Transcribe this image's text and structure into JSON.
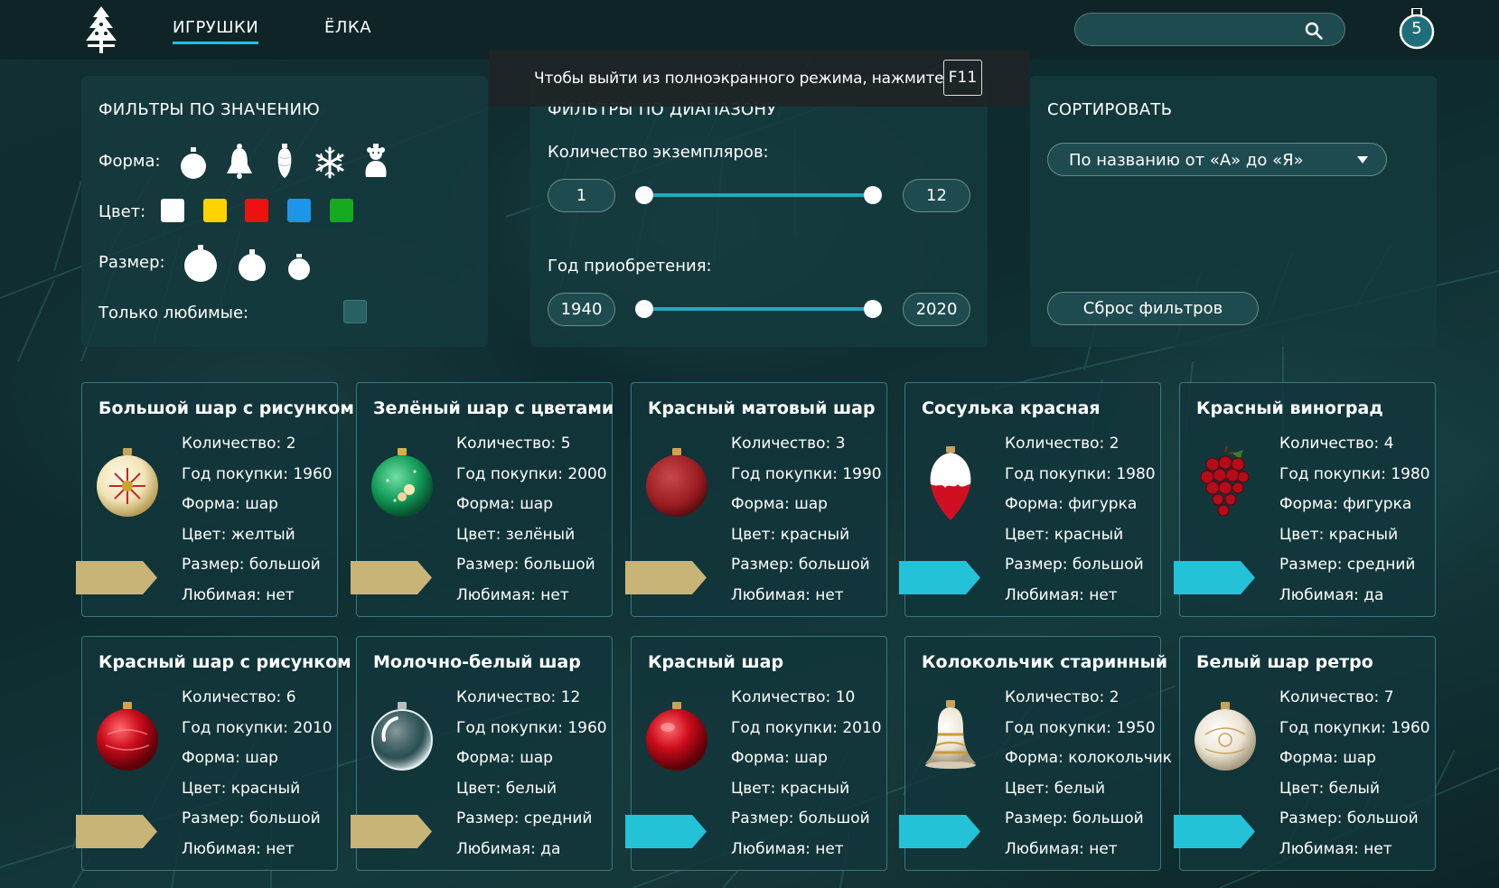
{
  "colors": {
    "accent": "#24c0d8",
    "ribbon_gold": "#c9b478",
    "ribbon_blue": "#23c2d7"
  },
  "header": {
    "nav": [
      {
        "label": "ИГРУШКИ",
        "active": true
      },
      {
        "label": "ЁЛКА",
        "active": false
      }
    ],
    "search": {
      "value": "",
      "placeholder": "",
      "icon": "search-icon"
    },
    "cart_count": "5"
  },
  "toast": {
    "text": "Чтобы выйти из полноэкранного режима, нажмите",
    "key": "F11"
  },
  "value_filters": {
    "title": "ФИЛЬТРЫ ПО ЗНАЧЕНИЮ",
    "shape_label": "Форма:",
    "shapes": [
      "ball-icon",
      "bell-icon",
      "cone-icon",
      "snowflake-icon",
      "figurine-icon"
    ],
    "color_label": "Цвет:",
    "colors": [
      "#ffffff",
      "#ffd200",
      "#ee1111",
      "#1e96e8",
      "#17aa1e"
    ],
    "size_label": "Размер:",
    "sizes": [
      "large-ball-icon",
      "medium-ball-icon",
      "small-ball-icon"
    ],
    "favorite_label": "Только любимые:"
  },
  "range_filters": {
    "title": "ФИЛЬТРЫ ПО ДИАПАЗОНУ",
    "count": {
      "label": "Количество экземпляров:",
      "min": "1",
      "max": "12"
    },
    "year": {
      "label": "Год приобретения:",
      "min": "1940",
      "max": "2020"
    }
  },
  "sort": {
    "title": "СОРТИРОВАТЬ",
    "selected": "По названию от «А» до «Я»",
    "reset_label": "Сброс фильтров"
  },
  "cards": [
    {
      "title": "Большой шар с рисунком",
      "count": "Количество: 2",
      "year": "Год покупки: 1960",
      "shape": "Форма: шар",
      "color": "Цвет: желтый",
      "size": "Размер: большой",
      "favorite": "Любимая: нет",
      "ribbon": "gold",
      "image": "yellow-ball"
    },
    {
      "title": "Зелёный шар с цветами",
      "count": "Количество: 5",
      "year": "Год покупки: 2000",
      "shape": "Форма: шар",
      "color": "Цвет: зелёный",
      "size": "Размер: большой",
      "favorite": "Любимая: нет",
      "ribbon": "gold",
      "image": "green-ball"
    },
    {
      "title": "Красный матовый шар",
      "count": "Количество: 3",
      "year": "Год покупки: 1990",
      "shape": "Форма: шар",
      "color": "Цвет: красный",
      "size": "Размер: большой",
      "favorite": "Любимая: нет",
      "ribbon": "gold",
      "image": "matte-red-ball"
    },
    {
      "title": "Сосулька красная",
      "count": "Количество: 2",
      "year": "Год покупки: 1980",
      "shape": "Форма: фигурка",
      "color": "Цвет: красный",
      "size": "Размер: большой",
      "favorite": "Любимая: нет",
      "ribbon": "blue",
      "image": "red-icicle"
    },
    {
      "title": "Красный виноград",
      "count": "Количество: 4",
      "year": "Год покупки: 1980",
      "shape": "Форма: фигурка",
      "color": "Цвет: красный",
      "size": "Размер: средний",
      "favorite": "Любимая: да",
      "ribbon": "blue",
      "image": "red-grapes"
    },
    {
      "title": "Красный шар с рисунком",
      "count": "Количество: 6",
      "year": "Год покупки: 2010",
      "shape": "Форма: шар",
      "color": "Цвет: красный",
      "size": "Размер: большой",
      "favorite": "Любимая: нет",
      "ribbon": "gold",
      "image": "red-pattern-ball"
    },
    {
      "title": "Молочно-белый шар",
      "count": "Количество: 12",
      "year": "Год покупки: 1960",
      "shape": "Форма: шар",
      "color": "Цвет: белый",
      "size": "Размер: средний",
      "favorite": "Любимая: да",
      "ribbon": "gold",
      "image": "clear-ball"
    },
    {
      "title": "Красный шар",
      "count": "Количество: 10",
      "year": "Год покупки: 2010",
      "shape": "Форма: шар",
      "color": "Цвет: красный",
      "size": "Размер: большой",
      "favorite": "Любимая: нет",
      "ribbon": "blue",
      "image": "red-ball"
    },
    {
      "title": "Колокольчик старинный",
      "count": "Количество: 2",
      "year": "Год покупки: 1950",
      "shape": "Форма: колокольчик",
      "color": "Цвет: белый",
      "size": "Размер: большой",
      "favorite": "Любимая: нет",
      "ribbon": "blue",
      "image": "white-bell"
    },
    {
      "title": "Белый шар ретро",
      "count": "Количество: 7",
      "year": "Год покупки: 1960",
      "shape": "Форма: шар",
      "color": "Цвет: белый",
      "size": "Размер: большой",
      "favorite": "Любимая: нет",
      "ribbon": "blue",
      "image": "white-retro-ball"
    }
  ]
}
